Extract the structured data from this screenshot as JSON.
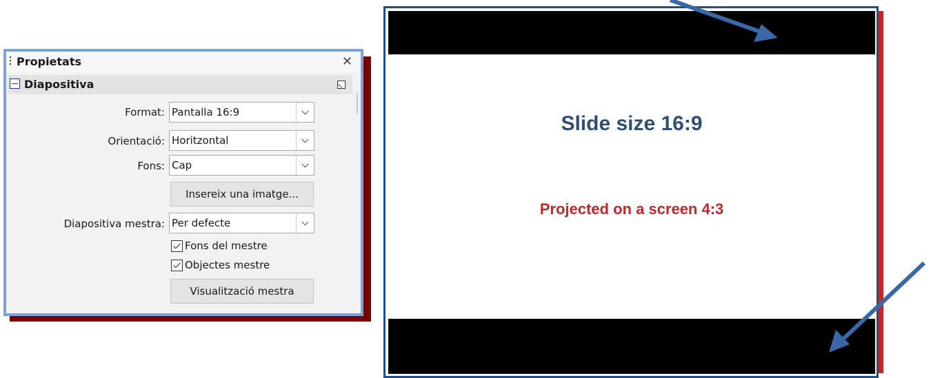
{
  "panel": {
    "title": "Propietats",
    "close_glyph": "✕",
    "section_title": "Diapositiva",
    "format_label": "Format:",
    "format_value": "Pantalla 16:9",
    "orientation_label": "Orientació:",
    "orientation_value": "Horitzontal",
    "background_label": "Fons:",
    "background_value": "Cap",
    "insert_image_button": "Insereix una imatge...",
    "master_slide_label": "Diapositiva mestra:",
    "master_slide_value": "Per defecte",
    "master_background_checkbox": "Fons del mestre",
    "master_background_checked": true,
    "master_objects_checkbox": "Objectes mestre",
    "master_objects_checked": true,
    "master_view_button": "Visualització mestra"
  },
  "slide": {
    "title": "Slide size 16:9",
    "subtitle": "Projected on a screen 4:3"
  },
  "colors": {
    "panel_border": "#7aa3d6",
    "panel_shadow": "#7a0000",
    "slide_border": "#1f4e8c",
    "red_edge": "#c1272d",
    "title_color": "#2f4f72",
    "subtitle_color": "#c1272d",
    "arrow_color": "#3a67a8"
  },
  "icons": [
    "grip-icon",
    "close-icon",
    "collapse-icon",
    "more-options-icon",
    "chevron-down-icon",
    "checkbox-checked-icon",
    "arrow-icon"
  ]
}
